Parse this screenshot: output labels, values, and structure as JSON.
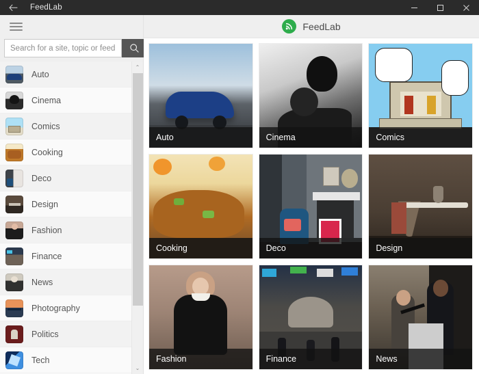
{
  "titlebar": {
    "back_icon": "back-arrow-icon",
    "title": "FeedLab",
    "minimize_label": "–",
    "maximize_label": "□",
    "close_label": "✕"
  },
  "sidebar": {
    "menu_icon": "hamburger-menu-icon",
    "search": {
      "placeholder": "Search for a site, topic or feed",
      "value": "",
      "button_icon": "search-icon"
    },
    "scrollbar": {
      "up_arrow": "⌃",
      "down_arrow": "⌄"
    },
    "items": [
      {
        "label": "Auto",
        "art": "t-auto"
      },
      {
        "label": "Cinema",
        "art": "t-cinema"
      },
      {
        "label": "Comics",
        "art": "t-comics"
      },
      {
        "label": "Cooking",
        "art": "t-cooking"
      },
      {
        "label": "Deco",
        "art": "t-deco"
      },
      {
        "label": "Design",
        "art": "t-design"
      },
      {
        "label": "Fashion",
        "art": "t-fashion"
      },
      {
        "label": "Finance",
        "art": "t-finance"
      },
      {
        "label": "News",
        "art": "t-news"
      },
      {
        "label": "Photography",
        "art": "t-photography"
      },
      {
        "label": "Politics",
        "art": "t-politics"
      },
      {
        "label": "Tech",
        "art": "t-tech"
      }
    ]
  },
  "header": {
    "logo_icon": "rss-feed-logo-icon",
    "logo_color": "#2eac4c",
    "app_name": "FeedLab"
  },
  "grid": {
    "tiles": [
      {
        "label": "Auto"
      },
      {
        "label": "Cinema"
      },
      {
        "label": "Comics"
      },
      {
        "label": "Cooking"
      },
      {
        "label": "Deco"
      },
      {
        "label": "Design"
      },
      {
        "label": "Fashion"
      },
      {
        "label": "Finance"
      },
      {
        "label": "News"
      }
    ]
  },
  "colors": {
    "titlebar_bg": "#2b2b2b",
    "sidebar_bg": "#f7f7f7",
    "header_bg": "#efefef",
    "accent_green": "#2eac4c",
    "caption_bg": "rgba(18,18,18,.78)"
  }
}
